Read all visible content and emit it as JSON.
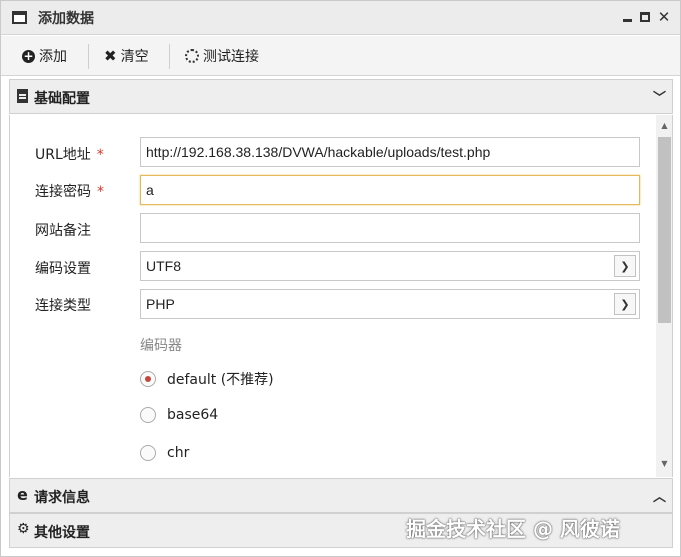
{
  "window": {
    "title": "添加数据",
    "minimize_icon": "minimize-icon",
    "maximize_icon": "maximize-icon",
    "close_icon": "close-icon"
  },
  "toolbar": {
    "add_label": "添加",
    "clear_label": "清空",
    "test_label": "测试连接"
  },
  "panels": {
    "basic": {
      "label": "基础配置",
      "icon": "document-icon",
      "chevron": "chevron-down-icon"
    },
    "request": {
      "label": "请求信息",
      "icon": "browser-e-icon",
      "chevron": "chevron-up-icon"
    },
    "other": {
      "label": "其他设置",
      "icon": "gears-icon"
    }
  },
  "form": {
    "url": {
      "label": "URL地址",
      "required_mark": "*",
      "value": "http://192.168.38.138/DVWA/hackable/uploads/test.php"
    },
    "password": {
      "label": "连接密码",
      "required_mark": "*",
      "value": "a"
    },
    "note": {
      "label": "网站备注",
      "value": ""
    },
    "encoding": {
      "label": "编码设置",
      "value": "UTF8"
    },
    "type": {
      "label": "连接类型",
      "value": "PHP"
    },
    "encoder": {
      "label": "编码器",
      "options": [
        {
          "label": "default (不推荐)",
          "checked": true
        },
        {
          "label": "base64",
          "checked": false
        },
        {
          "label": "chr",
          "checked": false
        }
      ]
    }
  },
  "watermark": "掘金技术社区 @ 风彼诺",
  "colors": {
    "required": "#d9362b",
    "focus_border": "#e6b85c",
    "radio_dot": "#c2483e"
  }
}
